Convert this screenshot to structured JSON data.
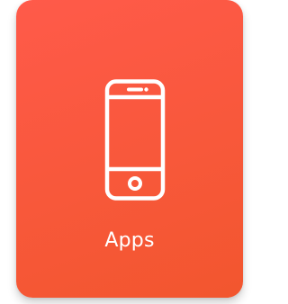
{
  "tile": {
    "label": "Apps",
    "icon": "smartphone-icon",
    "gradient_start": "#ff5a4a",
    "gradient_end": "#f2562e",
    "text_color": "#ffffff"
  }
}
